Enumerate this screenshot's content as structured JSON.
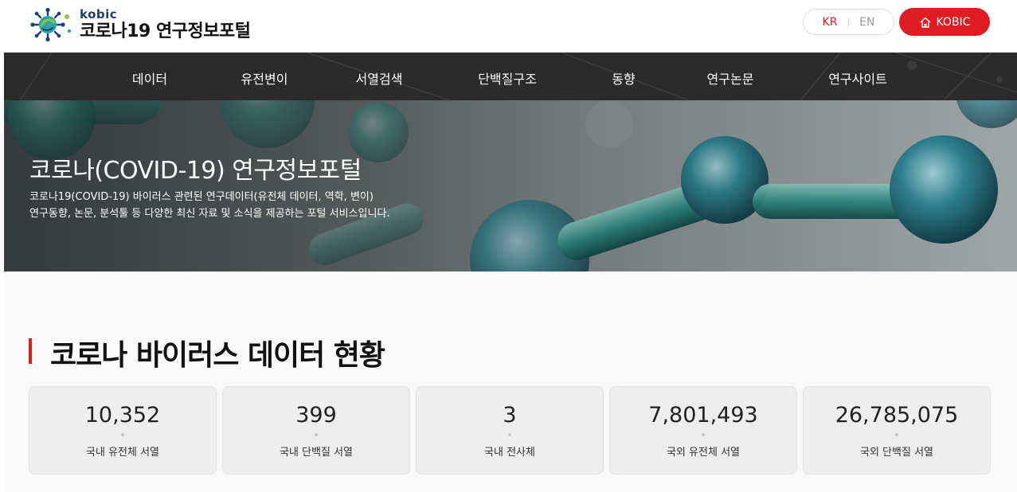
{
  "header": {
    "logo_brand": "kobic",
    "logo_title": "코로나19 연구정보포털",
    "lang_kr": "KR",
    "lang_separator": "|",
    "lang_en": "EN",
    "kobic_button": "KOBIC"
  },
  "nav": {
    "items": [
      "데이터",
      "유전변이",
      "서열검색",
      "단백질구조",
      "동향",
      "연구논문",
      "연구사이트"
    ]
  },
  "hero": {
    "title": "코로나(COVID-19) 연구정보포털",
    "desc_line1": "코로나19(COVID-19) 바이러스 관련된 연구데이터(유전체 데이터, 역학, 변이)",
    "desc_line2": "연구동향, 논문, 분석툴 등 다양한 최신 자료 및 소식을 제공하는 포털 서비스입니다."
  },
  "stats": {
    "title": "코로나 바이러스 데이터 현황",
    "cards": [
      {
        "value": "10,352",
        "label": "국내 유전체 서열"
      },
      {
        "value": "399",
        "label": "국내 단백질 서열"
      },
      {
        "value": "3",
        "label": "국내 전사체"
      },
      {
        "value": "7,801,493",
        "label": "국외 유전체 서열"
      },
      {
        "value": "26,785,075",
        "label": "국외 단백질 서열"
      }
    ]
  },
  "colors": {
    "accent": "#e11b22",
    "nav_bg": "#2b2b2b",
    "brand_blue": "#1b3f73"
  },
  "icons": {
    "logo": "virus-logo-icon",
    "kobic": "home-icon"
  }
}
